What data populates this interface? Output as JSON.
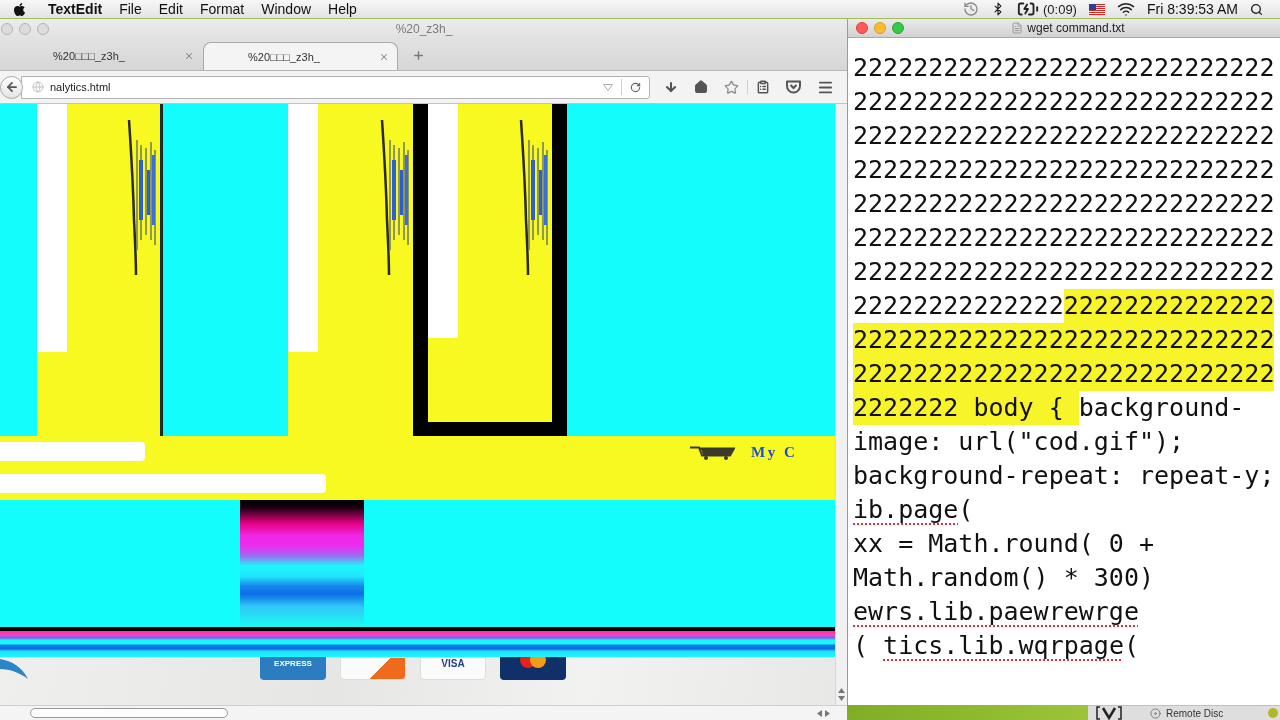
{
  "menu_bar": {
    "app_name": "TextEdit",
    "items": [
      "File",
      "Edit",
      "Format",
      "Window",
      "Help"
    ],
    "battery_time": "(0:09)",
    "clock": "Fri 8:39:53 AM"
  },
  "browser": {
    "active": false,
    "title": "%20_z3h_",
    "tabs": [
      {
        "label": "%20□□□_z3h_",
        "selected": false
      },
      {
        "label": "%20□□□_z3h_",
        "selected": true
      }
    ],
    "url": "nalytics.html",
    "page": {
      "cart_label": "My C",
      "payment_cards": [
        {
          "kind": "amex",
          "label": "EXPRESS"
        },
        {
          "kind": "discover"
        },
        {
          "kind": "visa",
          "label": "VISA"
        },
        {
          "kind": "mastercard"
        }
      ]
    }
  },
  "editor": {
    "active": true,
    "title": "wget command.txt",
    "lines": [
      [
        {
          "text": "2222222222222222222222222222",
          "highlighted": false,
          "misspelled": false
        }
      ],
      [
        {
          "text": "2222222222222222222222222222",
          "highlighted": false,
          "misspelled": false
        }
      ],
      [
        {
          "text": "2222222222222222222222222222",
          "highlighted": false,
          "misspelled": false
        }
      ],
      [
        {
          "text": "2222222222222222222222222222",
          "highlighted": false,
          "misspelled": false
        }
      ],
      [
        {
          "text": "2222222222222222222222222222",
          "highlighted": false,
          "misspelled": false
        }
      ],
      [
        {
          "text": "2222222222222222222222222222",
          "highlighted": false,
          "misspelled": false
        }
      ],
      [
        {
          "text": "2222222222222222222222222222",
          "highlighted": false,
          "misspelled": false
        }
      ],
      [
        {
          "text": "22222222222222",
          "highlighted": false,
          "misspelled": false
        },
        {
          "text": "22222222222222",
          "highlighted": true,
          "misspelled": false
        }
      ],
      [
        {
          "text": "2222222222222222222222222222",
          "highlighted": true,
          "misspelled": false
        }
      ],
      [
        {
          "text": "2222222222222222222222222222",
          "highlighted": true,
          "misspelled": false
        }
      ],
      [
        {
          "text": "2222222 body { ",
          "highlighted": true,
          "misspelled": false
        },
        {
          "text": "background-",
          "highlighted": false,
          "misspelled": false
        }
      ],
      [
        {
          "text": "image: url(\"cod.gif\");",
          "highlighted": false,
          "misspelled": false
        }
      ],
      [
        {
          "text": "background-repeat: repeat-y;",
          "highlighted": false,
          "misspelled": false
        }
      ],
      [
        {
          "text": "ib.page",
          "highlighted": false,
          "misspelled": true
        },
        {
          "text": "(",
          "highlighted": false,
          "misspelled": false
        }
      ],
      [
        {
          "text": "xx = Math.round( 0 +",
          "highlighted": false,
          "misspelled": false
        }
      ],
      [
        {
          "text": "Math.random() * 300)",
          "highlighted": false,
          "misspelled": false
        }
      ],
      [
        {
          "text": "ewrs.lib.paewrewrge",
          "highlighted": false,
          "misspelled": true
        }
      ],
      [
        {
          "text": "( ",
          "highlighted": false,
          "misspelled": false
        },
        {
          "text": "tics.lib.wqrpage",
          "highlighted": false,
          "misspelled": true
        },
        {
          "text": "(",
          "highlighted": false,
          "misspelled": false
        }
      ]
    ]
  },
  "finder": {
    "sidebar_item": "Remote Disc"
  }
}
